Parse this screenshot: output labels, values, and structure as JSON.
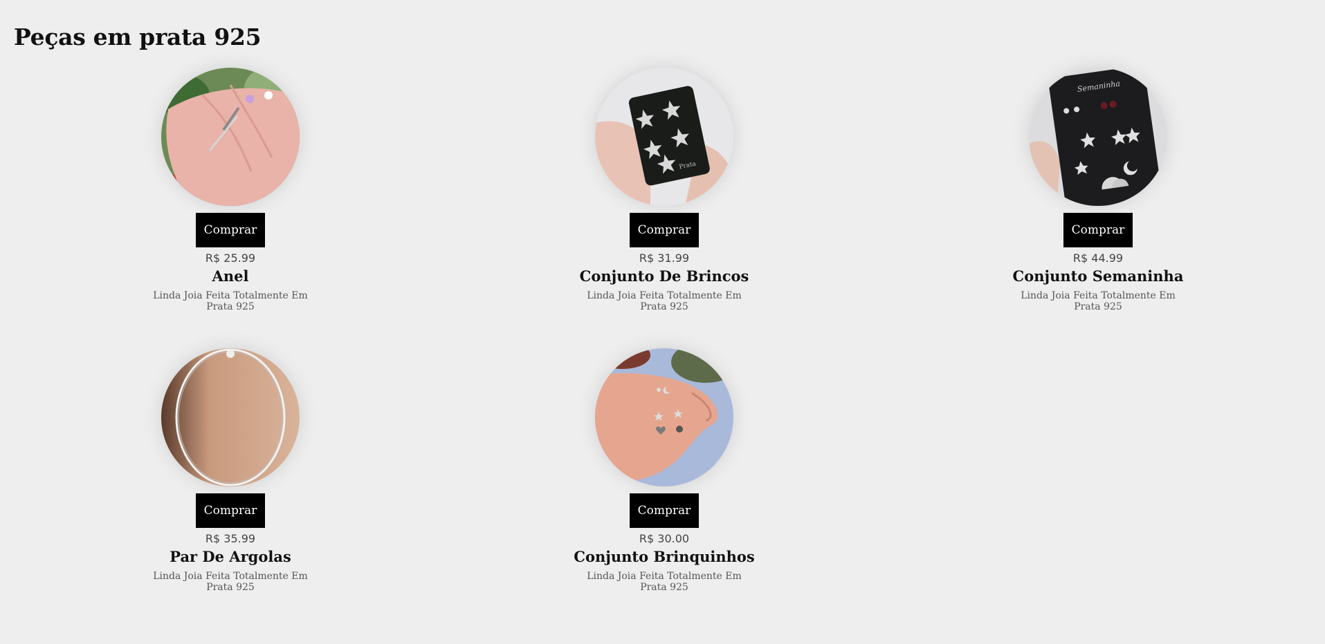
{
  "page": {
    "title": "Peças em prata 925"
  },
  "products": [
    {
      "name": "Anel",
      "price": "R$ 25.99",
      "buy_label": "Comprar",
      "description": "Linda Joia Feita Totalmente Em Prata 925",
      "photo": "silver-rings-on-hand"
    },
    {
      "name": "Conjunto De Brincos",
      "price": "R$ 31.99",
      "buy_label": "Comprar",
      "description": "Linda Joia Feita Totalmente Em Prata 925",
      "photo": "starfish-earrings-card"
    },
    {
      "name": "Conjunto Semaninha",
      "price": "R$ 44.99",
      "buy_label": "Comprar",
      "description": "Linda Joia Feita Totalmente Em Prata 925",
      "photo": "week-earrings-card"
    },
    {
      "name": "Par De Argolas",
      "price": "R$ 35.99",
      "buy_label": "Comprar",
      "description": "Linda Joia Feita Totalmente Em Prata 925",
      "photo": "hoop-earrings"
    },
    {
      "name": "Conjunto Brinquinhos",
      "price": "R$ 30.00",
      "buy_label": "Comprar",
      "description": "Linda Joia Feita Totalmente Em Prata 925",
      "photo": "small-earrings-in-hand"
    }
  ]
}
